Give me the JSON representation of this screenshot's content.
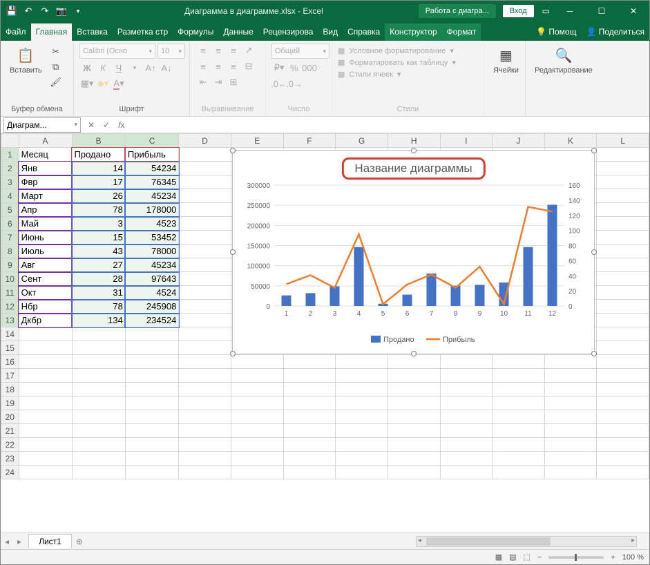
{
  "titlebar": {
    "filename": "Диаграмма в диаграмме.xlsx - Excel",
    "context": "Работа с диагра...",
    "login": "Вход"
  },
  "tabs": [
    "Файл",
    "Главная",
    "Вставка",
    "Разметка стр",
    "Формулы",
    "Данные",
    "Рецензирова",
    "Вид",
    "Справка",
    "Конструктор",
    "Формат"
  ],
  "tabs_active": 1,
  "tell_me": "Помощ",
  "share": "Поделиться",
  "ribbon": {
    "clipboard": {
      "label": "Буфер обмена",
      "paste": "Вставить"
    },
    "font": {
      "label": "Шрифт",
      "name": "Calibri (Осно",
      "size": "10"
    },
    "align": {
      "label": "Выравнивание"
    },
    "number": {
      "label": "Число",
      "format": "Общий"
    },
    "styles": {
      "label": "Стили",
      "cond": "Условное форматирование",
      "table": "Форматировать как таблицу",
      "cell": "Стили ячеек"
    },
    "cells": {
      "label": "Ячейки"
    },
    "editing": {
      "label": "Редактирование"
    }
  },
  "namebox": "Диаграм...",
  "columns": [
    "A",
    "B",
    "C",
    "D",
    "E",
    "F",
    "G",
    "H",
    "I",
    "J",
    "K",
    "L"
  ],
  "headers": [
    "Месяц",
    "Продано",
    "Прибыль"
  ],
  "rows": [
    [
      "Янв",
      "14",
      "54234"
    ],
    [
      "Фвр",
      "17",
      "76345"
    ],
    [
      "Март",
      "26",
      "45234"
    ],
    [
      "Апр",
      "78",
      "178000"
    ],
    [
      "Май",
      "3",
      "4523"
    ],
    [
      "Июнь",
      "15",
      "53452"
    ],
    [
      "Июль",
      "43",
      "78000"
    ],
    [
      "Авг",
      "27",
      "45234"
    ],
    [
      "Сент",
      "28",
      "97643"
    ],
    [
      "Окт",
      "31",
      "4524"
    ],
    [
      "Нбр",
      "78",
      "245908"
    ],
    [
      "Дкбр",
      "134",
      "234524"
    ]
  ],
  "chart_data": {
    "type": "combo",
    "title": "Название диаграммы",
    "categories": [
      "1",
      "2",
      "3",
      "4",
      "5",
      "6",
      "7",
      "8",
      "9",
      "10",
      "11",
      "12"
    ],
    "series": [
      {
        "name": "Продано",
        "type": "bar",
        "axis": "right",
        "values": [
          14,
          17,
          26,
          78,
          3,
          15,
          43,
          27,
          28,
          31,
          78,
          134
        ]
      },
      {
        "name": "Прибыль",
        "type": "line",
        "axis": "left",
        "values": [
          54234,
          76345,
          45234,
          178000,
          4523,
          53452,
          78000,
          45234,
          97643,
          4524,
          245908,
          234524
        ]
      }
    ],
    "y_left": {
      "min": 0,
      "max": 300000,
      "step": 50000
    },
    "y_right": {
      "min": 0,
      "max": 160,
      "step": 20
    },
    "legend": [
      "Продано",
      "Прибыль"
    ]
  },
  "sheet_tab": "Лист1",
  "zoom": "100 %"
}
